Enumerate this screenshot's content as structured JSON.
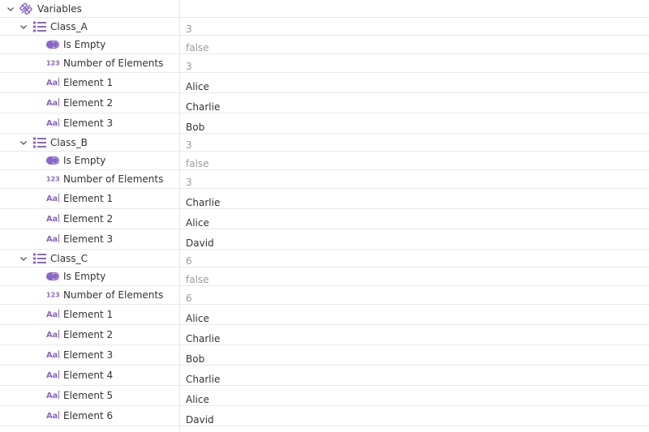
{
  "colors": {
    "accent": "#8a65c9",
    "muted_value": "#9a9a9a",
    "text": "#333333",
    "row_border": "#e9e9ee"
  },
  "root": {
    "label": "Variables",
    "icon": "variables-icon",
    "expanded": true
  },
  "classes": [
    {
      "label": "Class_A",
      "icon": "list-icon",
      "value": "3",
      "expanded": true,
      "is_empty": {
        "label": "Is Empty",
        "value": "false",
        "icon": "toggle-icon"
      },
      "count": {
        "label": "Number of Elements",
        "value": "3",
        "icon": "number-icon"
      },
      "elements": [
        {
          "label": "Element 1",
          "value": "Alice",
          "icon": "text-icon"
        },
        {
          "label": "Element 2",
          "value": "Charlie",
          "icon": "text-icon"
        },
        {
          "label": "Element 3",
          "value": "Bob",
          "icon": "text-icon"
        }
      ]
    },
    {
      "label": "Class_B",
      "icon": "list-icon",
      "value": "3",
      "expanded": true,
      "is_empty": {
        "label": "Is Empty",
        "value": "false",
        "icon": "toggle-icon"
      },
      "count": {
        "label": "Number of Elements",
        "value": "3",
        "icon": "number-icon"
      },
      "elements": [
        {
          "label": "Element 1",
          "value": "Charlie",
          "icon": "text-icon"
        },
        {
          "label": "Element 2",
          "value": "Alice",
          "icon": "text-icon"
        },
        {
          "label": "Element 3",
          "value": "David",
          "icon": "text-icon"
        }
      ]
    },
    {
      "label": "Class_C",
      "icon": "list-icon",
      "value": "6",
      "expanded": true,
      "is_empty": {
        "label": "Is Empty",
        "value": "false",
        "icon": "toggle-icon"
      },
      "count": {
        "label": "Number of Elements",
        "value": "6",
        "icon": "number-icon"
      },
      "elements": [
        {
          "label": "Element 1",
          "value": "Alice",
          "icon": "text-icon"
        },
        {
          "label": "Element 2",
          "value": "Charlie",
          "icon": "text-icon"
        },
        {
          "label": "Element 3",
          "value": "Bob",
          "icon": "text-icon"
        },
        {
          "label": "Element 4",
          "value": "Charlie",
          "icon": "text-icon"
        },
        {
          "label": "Element 5",
          "value": "Alice",
          "icon": "text-icon"
        },
        {
          "label": "Element 6",
          "value": "David",
          "icon": "text-icon"
        }
      ]
    }
  ]
}
